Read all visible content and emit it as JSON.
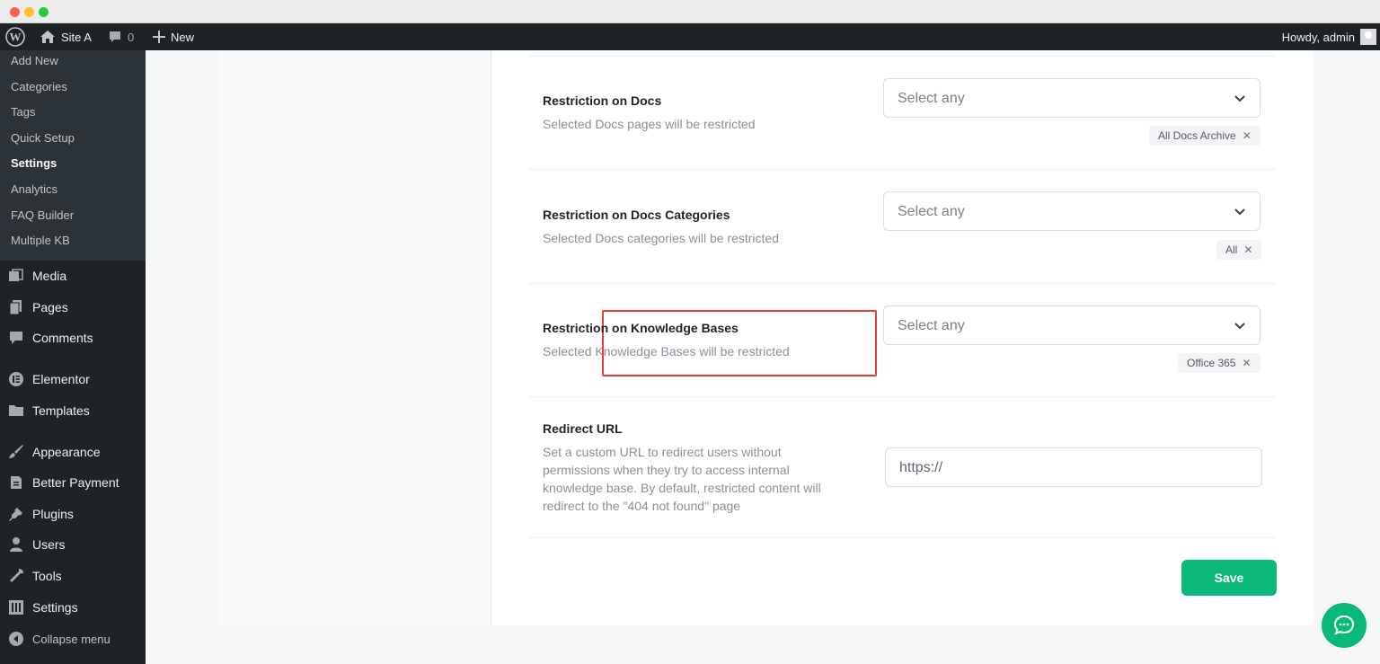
{
  "adminbar": {
    "site_name": "Site A",
    "comments_count": "0",
    "new_label": "New",
    "howdy": "Howdy, admin"
  },
  "sidebar": {
    "submenu": [
      {
        "label": "Add New"
      },
      {
        "label": "Categories"
      },
      {
        "label": "Tags"
      },
      {
        "label": "Quick Setup"
      },
      {
        "label": "Settings"
      },
      {
        "label": "Analytics"
      },
      {
        "label": "FAQ Builder"
      },
      {
        "label": "Multiple KB"
      }
    ],
    "menu": [
      {
        "label": "Media",
        "icon": "media-icon"
      },
      {
        "label": "Pages",
        "icon": "pages-icon"
      },
      {
        "label": "Comments",
        "icon": "comments-icon"
      },
      {
        "label": "Elementor",
        "icon": "elementor-icon"
      },
      {
        "label": "Templates",
        "icon": "folder-icon"
      },
      {
        "label": "Appearance",
        "icon": "brush-icon"
      },
      {
        "label": "Better Payment",
        "icon": "payment-icon"
      },
      {
        "label": "Plugins",
        "icon": "plug-icon"
      },
      {
        "label": "Users",
        "icon": "user-icon"
      },
      {
        "label": "Tools",
        "icon": "wrench-icon"
      },
      {
        "label": "Settings",
        "icon": "settings-icon"
      }
    ],
    "collapse_label": "Collapse menu"
  },
  "settings": {
    "docs": {
      "title": "Restriction on Docs",
      "desc": "Selected Docs pages will be restricted",
      "placeholder": "Select any",
      "tag": "All Docs Archive"
    },
    "categories": {
      "title": "Restriction on Docs Categories",
      "desc": "Selected Docs categories will be restricted",
      "placeholder": "Select any",
      "tag": "All"
    },
    "kb": {
      "title": "Restriction on Knowledge Bases",
      "desc": "Selected Knowledge Bases will be restricted",
      "placeholder": "Select any",
      "tag": "Office 365"
    },
    "redirect": {
      "title": "Redirect URL",
      "desc_lines": [
        "Set a custom URL to redirect users without",
        "permissions when they try to access internal",
        "knowledge base. By default, restricted content will",
        "redirect to the \"404 not found\" page"
      ],
      "value": "https://"
    },
    "save_label": "Save"
  },
  "colors": {
    "accent": "#0ab87a",
    "highlight": "#e53e3e",
    "admin_dark": "#1d2327"
  }
}
